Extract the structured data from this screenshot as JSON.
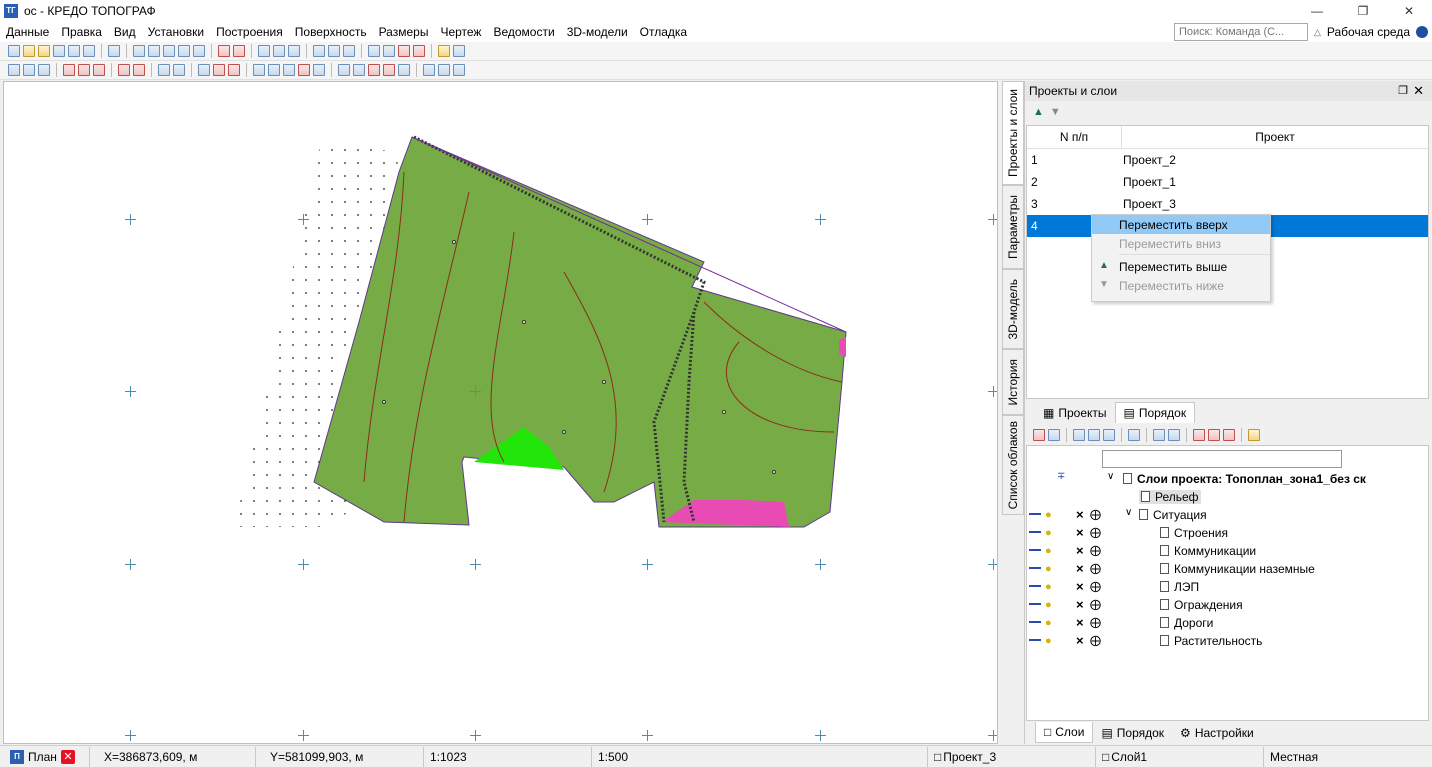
{
  "window": {
    "title": "ос - КРЕДО ТОПОГРАФ",
    "icon": "credo-app-icon"
  },
  "menu": [
    "Данные",
    "Правка",
    "Вид",
    "Установки",
    "Построения",
    "Поверхность",
    "Размеры",
    "Чертеж",
    "Ведомости",
    "3D-модели",
    "Отладка"
  ],
  "search": {
    "placeholder": "Поиск: Команда (С..."
  },
  "workspace_label": "Рабочая среда",
  "side_tabs": [
    "Проекты и слои",
    "Параметры",
    "3D-модель",
    "История",
    "Список облаков"
  ],
  "projects_panel": {
    "title": "Проекты и слои",
    "columns": {
      "num": "N п/п",
      "name": "Проект"
    },
    "rows": [
      {
        "num": "1",
        "name": "Проект_2"
      },
      {
        "num": "2",
        "name": "Проект_1"
      },
      {
        "num": "3",
        "name": "Проект_3"
      },
      {
        "num": "4",
        "name": ""
      }
    ],
    "tabs": {
      "projects": "Проекты",
      "order": "Порядок"
    }
  },
  "context_menu": {
    "items": [
      {
        "label": "Переместить вверх",
        "state": "highlighted"
      },
      {
        "label": "Переместить вниз",
        "state": "disabled"
      },
      {
        "label": "Переместить выше",
        "state": "enabled"
      },
      {
        "label": "Переместить ниже",
        "state": "disabled"
      }
    ]
  },
  "layers": {
    "root": "Слои проекта: Топоплан_зона1_без ск",
    "relief": "Рельеф",
    "situation": "Ситуация",
    "children": [
      "Строения",
      "Коммуникации",
      "Коммуникации наземные",
      "ЛЭП",
      "Ограждения",
      "Дороги",
      "Растительность"
    ]
  },
  "bottom_tabs": {
    "layers": "Слои",
    "order": "Порядок",
    "settings": "Настройки"
  },
  "status": {
    "plan_tab": "План",
    "x": "X=386873,609, м",
    "y": "Y=581099,903, м",
    "scale1": "1:1023",
    "scale2": "1:500",
    "project": "Проект_3",
    "layer": "Слой1",
    "cs": "Местная"
  },
  "colors": {
    "terrain": "#76ab45",
    "highlight_green": "#22e60a",
    "pink": "#e84bb4",
    "selection": "#0078d7",
    "menu_highlight": "#91c9f7"
  }
}
